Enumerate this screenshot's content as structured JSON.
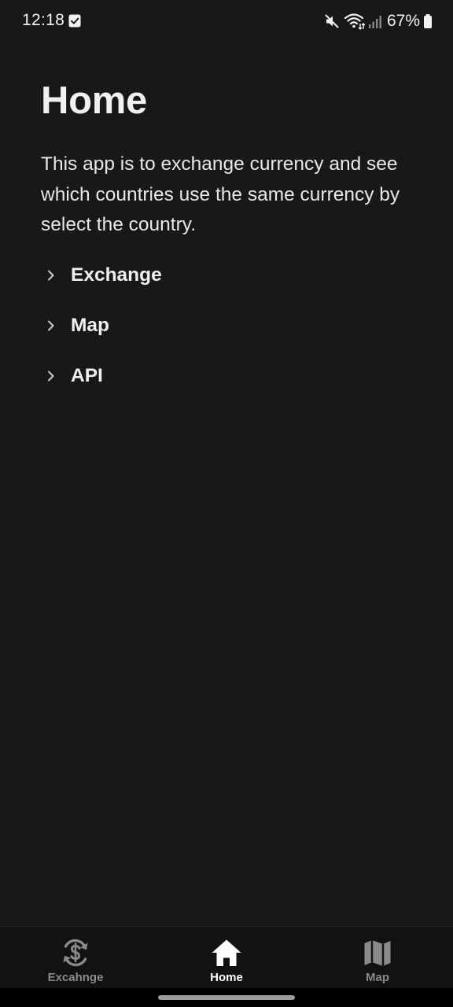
{
  "status_bar": {
    "time": "12:18",
    "battery": "67%"
  },
  "page": {
    "title": "Home",
    "description": "This app is to exchange currency and see which countries use the same currency by select the country."
  },
  "links": [
    {
      "label": "Exchange",
      "icon": "chevron-right-icon"
    },
    {
      "label": "Map",
      "icon": "chevron-right-icon"
    },
    {
      "label": "API",
      "icon": "chevron-right-icon"
    }
  ],
  "bottom_nav": {
    "items": [
      {
        "label": "Excahnge",
        "icon": "currency-exchange-icon",
        "active": false
      },
      {
        "label": "Home",
        "icon": "home-icon",
        "active": true
      },
      {
        "label": "Map",
        "icon": "map-icon",
        "active": false
      }
    ]
  },
  "colors": {
    "background": "#18181a",
    "text": "#ececec",
    "nav_background": "#121212",
    "nav_inactive": "#8a8a8a",
    "nav_active": "#ffffff"
  }
}
